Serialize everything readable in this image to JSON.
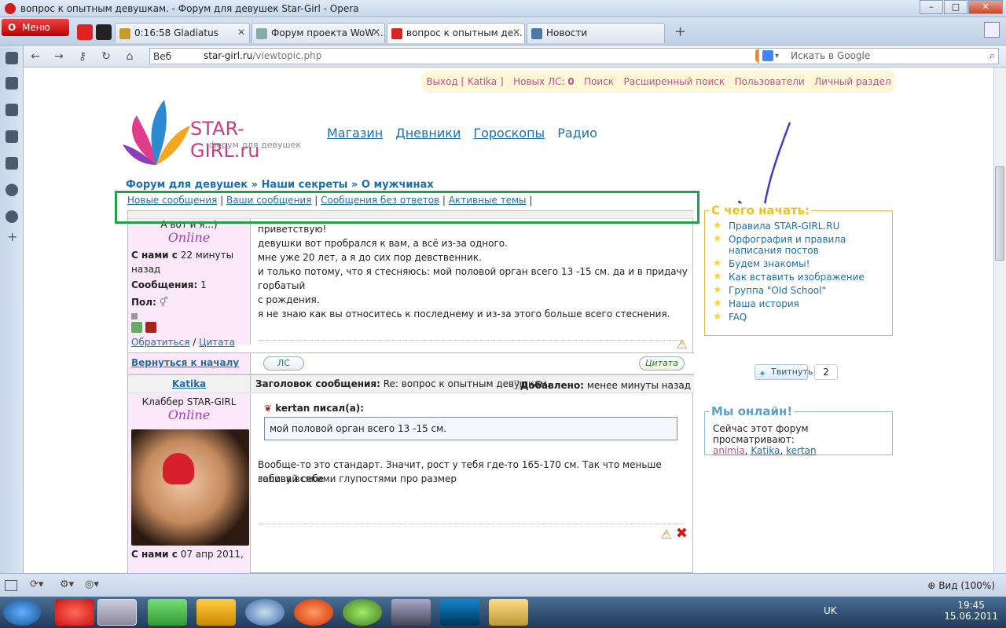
{
  "window": {
    "title": "вопрос к опытным девушкам. - Форум для девушек Star-Girl - Opera"
  },
  "browser": {
    "menu_label": "Меню",
    "tabs": [
      {
        "label": "0:16:58 Gladiatus"
      },
      {
        "label": "Форум проекта WoW ..."
      },
      {
        "label": "вопрос к опытным де..."
      },
      {
        "label": "Новости"
      }
    ],
    "address": {
      "prefix": "Веб",
      "host": "star-girl.ru",
      "path": "/viewtopic.php"
    },
    "search_placeholder": "Искать в Google",
    "zoom_label": "Вид (100%)"
  },
  "site": {
    "logo_text": "STAR-GIRL.ru",
    "logo_sub": "форум для девушек",
    "top_links": {
      "logout": "Выход [ Katika ]",
      "new_pm": "Новых ЛС:",
      "new_pm_count": "0",
      "search": "Поиск",
      "advanced_search": "Расширенный поиск",
      "users": "Пользователи",
      "personal": "Личный раздел"
    },
    "main_nav": [
      "Магазин",
      "Дневники",
      "Гороскопы",
      "Радио"
    ],
    "breadcrumb": [
      "Форум для девушек",
      "Наши секреты",
      "О мужчинах"
    ],
    "sub_nav": [
      "Новые сообщения",
      "Ваши сообщения",
      "Сообщения без ответов",
      "Активные темы"
    ]
  },
  "post1": {
    "author_partial": "А вот и я...)",
    "status": "Online",
    "joined_label": "С нами с",
    "joined_value": "22 минуты назад",
    "posts_label": "Сообщения:",
    "posts_value": "1",
    "gender_label": "Пол:",
    "contact_link": "Обратиться",
    "quote_link": "Цитата",
    "head_right": "Добавлено: менее минуты назад",
    "lines": [
      "приветствую!",
      "девушки вот пробрался к вам, а всё из-за одного.",
      "мне уже 20 лет, а я до сих пор девственник.",
      "и только потому, что я стесняюсь: мой половой орган всего 13 -15 см. да и в придачу горбатый",
      "с рождения.",
      "я не знаю как вы относитесь к последнему и из-за этого больше всего стеснения."
    ],
    "back_to_top": "Вернуться к началу",
    "pm_button": "ЛС",
    "quote_button": "Цитата"
  },
  "post2": {
    "author": "Katika",
    "subject_label": "Заголовок сообщения:",
    "subject_value": "Re: вопрос к опытным девушкам.",
    "added_label": "Добавлено:",
    "added_value": "менее минуты назад",
    "rank": "Клаббер STAR-GIRL",
    "status": "Online",
    "joined_label": "С нами с",
    "joined_value": "07 апр 2011,",
    "quote_author": "kertan писал(а):",
    "quote_text": "мой половой орган всего 13 -15 см.",
    "lines": [
      "Вообще-то это стандарт. Значит, рост у тебя где-то 165-170 см. Так что меньше забивай себе",
      "голову всякими глупостями про размер"
    ]
  },
  "sidebar_right": {
    "start_title": "С чего начать:",
    "start_links": [
      "Правила STAR-GIRL.RU",
      "Орфография и правила написания постов",
      "Будем знакомы!",
      "Как вставить изображение",
      "Группа \"Old School\"",
      "Наша история",
      "FAQ"
    ],
    "tweet_label": "Твитнуть",
    "tweet_count": "2",
    "online_title": "Мы онлайн!",
    "online_text": "Сейчас этот форум просматривают:",
    "online_users": [
      "animia",
      "Katika",
      "kertan"
    ]
  },
  "taskbar": {
    "lang": "UK",
    "time": "19:45",
    "date": "15.06.2011"
  },
  "colors": {
    "link": "#1f6fae",
    "pink": "#c2508c",
    "highlight_box": "#22a04a",
    "profile_bg": "#fbe9fb"
  }
}
